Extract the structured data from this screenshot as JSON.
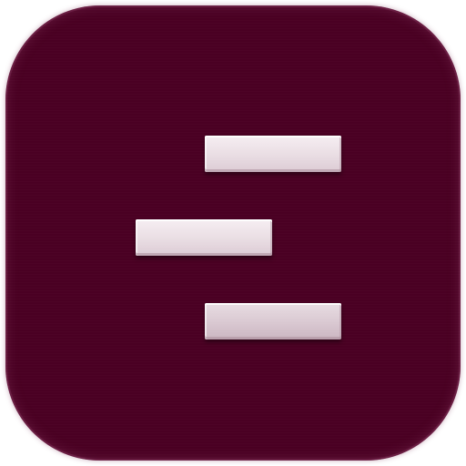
{
  "icon": {
    "name": "timeline-bars-icon",
    "background_color": "#4a0023",
    "bar_color": "#eee2e8",
    "bars": [
      "top",
      "middle",
      "bottom"
    ]
  }
}
